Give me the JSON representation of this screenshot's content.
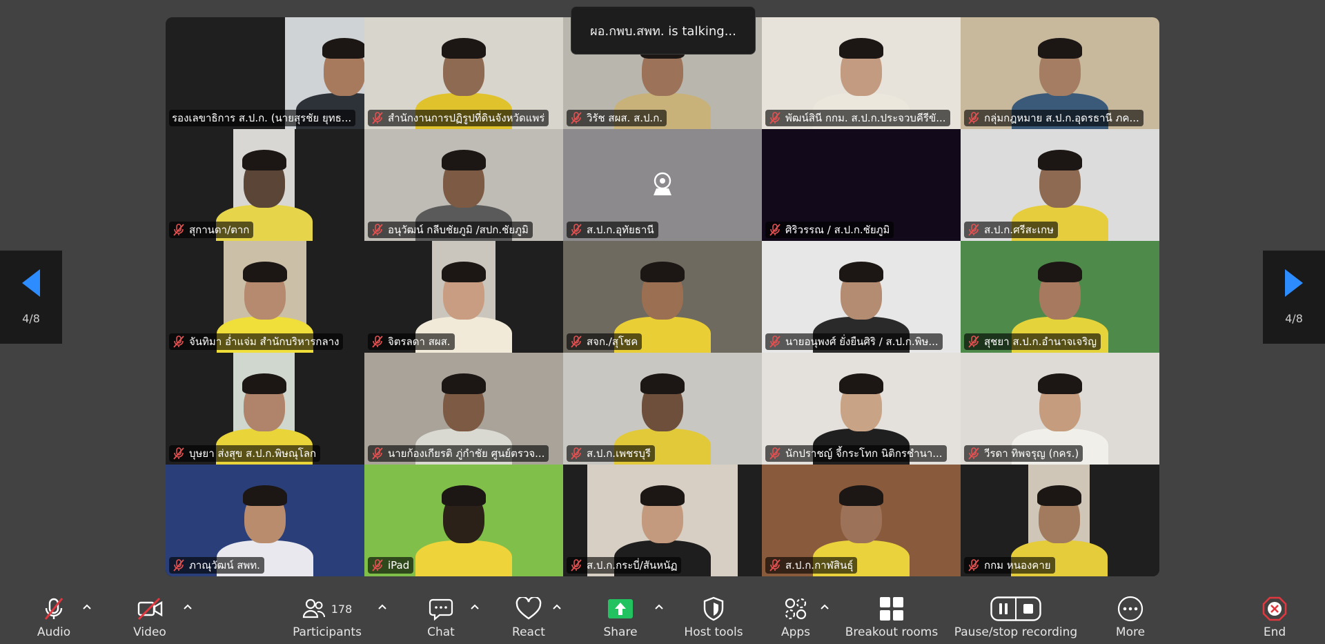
{
  "speaker_banner": "ผอ.กพบ.สพท. is talking...",
  "pager": {
    "left_label": "4/8",
    "right_label": "4/8"
  },
  "participants": [
    {
      "name": "รองเลขาธิการ ส.ป.ก. (นายสุรชัย ยุทธ...",
      "muted": false,
      "bg": "#cfd3d6",
      "cam": [
        60,
        60
      ],
      "skin": "#a77a5e",
      "shirt": "#2d3138"
    },
    {
      "name": "สำนักงานการปฏิรูปที่ดินจังหวัดแพร่",
      "muted": true,
      "bg": "#d8d5cc",
      "cam": [
        0,
        100
      ],
      "skin": "#8f6a52",
      "shirt": "#e0c22c"
    },
    {
      "name": "วิรัช  สผส.  ส.ป.ก.",
      "muted": true,
      "bg": "#b9b6ae",
      "cam": [
        0,
        100
      ],
      "skin": "#9c7258",
      "shirt": "#c9b27a"
    },
    {
      "name": "พัฒน์สินี กกม. ส.ป.ก.ประจวบคีรีขั...",
      "muted": true,
      "bg": "#e8e3da",
      "cam": [
        0,
        100
      ],
      "skin": "#c39b80",
      "shirt": "#ece7dd"
    },
    {
      "name": "กลุ่มกฎหมาย ส.ป.ก.อุดรธานี  ภค...",
      "muted": true,
      "bg": "#c8b89c",
      "cam": [
        0,
        100
      ],
      "skin": "#a57d62",
      "shirt": "#3b5a7a"
    },
    {
      "name": "สุกานดา/ตาก",
      "muted": true,
      "bg": "#d9d7d4",
      "cam": [
        34,
        31
      ],
      "skin": "#5a4536",
      "shirt": "#e6d44a"
    },
    {
      "name": "อนุวัฒน์ กลีบชัยภูมิ /สปก.ชัยภูมิ",
      "muted": true,
      "bg": "#bfbcb6",
      "cam": [
        0,
        100
      ],
      "skin": "#7c5a44",
      "shirt": "#5a5a5a"
    },
    {
      "name": "ส.ป.ก.อุทัยธานี",
      "muted": true,
      "bg": "#8c8a8d",
      "cam": [
        0,
        100
      ],
      "skin": "",
      "shirt": "",
      "placeholder": true
    },
    {
      "name": "ศิริวรรณ / ส.ป.ก.ชัยภูมิ",
      "muted": true,
      "bg": "#120a1a",
      "cam": [
        0,
        100
      ],
      "skin": "",
      "shirt": ""
    },
    {
      "name": "ส.ป.ก.ศรีสะเกษ",
      "muted": true,
      "bg": "#dcdcdc",
      "cam": [
        0,
        100
      ],
      "skin": "#8e6a52",
      "shirt": "#e6cd3e"
    },
    {
      "name": "จันทิมา อ่ำแจ่ม สำนักบริหารกลาง",
      "muted": true,
      "bg": "#cbbfa8",
      "cam": [
        29,
        42
      ],
      "skin": "#b68a6e",
      "shirt": "#f0de3a"
    },
    {
      "name": "จิตรลดา สผส.",
      "muted": true,
      "bg": "#cbc6bd",
      "cam": [
        34,
        32
      ],
      "skin": "#c99d82",
      "shirt": "#f1ead8"
    },
    {
      "name": "สจก./สุโชค",
      "muted": true,
      "bg": "#6e6a60",
      "cam": [
        0,
        100
      ],
      "skin": "#9b6f52",
      "shirt": "#e9cf35"
    },
    {
      "name": "นายอนุพงศ์  ยั่งยืนศิริ / ส.ป.ก.พิษ...",
      "muted": true,
      "bg": "#e7e7e7",
      "cam": [
        0,
        100
      ],
      "skin": "#b38c72",
      "shirt": "#2a2a2a"
    },
    {
      "name": "สุชยา ส.ป.ก.อำนาจเจริญ",
      "muted": true,
      "bg": "#4e8a4a",
      "cam": [
        0,
        100
      ],
      "skin": "#a77a60",
      "shirt": "#e5d33c"
    },
    {
      "name": "บุษยา ส่งสุข ส.ป.ก.พิษณุโลก",
      "muted": true,
      "bg": "#cfd7cf",
      "cam": [
        34,
        31
      ],
      "skin": "#b0846a",
      "shirt": "#e9d43a"
    },
    {
      "name": "นายก้องเกียรติ ภู่กำชัย ศูนย์ตรวจ...",
      "muted": true,
      "bg": "#a9a39a",
      "cam": [
        0,
        100
      ],
      "skin": "#7c5a44",
      "shirt": "#d9d9d2"
    },
    {
      "name": "ส.ป.ก.เพชรบุรี",
      "muted": true,
      "bg": "#c9c7c2",
      "cam": [
        0,
        100
      ],
      "skin": "#6d4f3c",
      "shirt": "#e2c93a"
    },
    {
      "name": "นักปราชญ์ จี้กระโทก นิติกรชำนา...",
      "muted": true,
      "bg": "#e4e1dd",
      "cam": [
        0,
        100
      ],
      "skin": "#c9a385",
      "shirt": "#1f1f1f"
    },
    {
      "name": "วีรดา ทิพจรุญ (กคร.)",
      "muted": true,
      "bg": "#dedad5",
      "cam": [
        0,
        100
      ],
      "skin": "#c59c7e",
      "shirt": "#f0efe9"
    },
    {
      "name": "ภาณุวัฒน์ สพท.",
      "muted": true,
      "bg": "#2a3f7a",
      "cam": [
        0,
        100
      ],
      "skin": "#b88c6c",
      "shirt": "#e8e8ee"
    },
    {
      "name": "iPad",
      "muted": true,
      "bg": "#7fbf4a",
      "cam": [
        0,
        100
      ],
      "skin": "#2b2118",
      "shirt": "#eed43a"
    },
    {
      "name": "ส.ป.ก.กระบี่/สันหนัฏ",
      "muted": true,
      "bg": "#d7cfc4",
      "cam": [
        12,
        76
      ],
      "skin": "#c49a7e",
      "shirt": "#1e1e1e"
    },
    {
      "name": "ส.ป.ก.กาฬสินธุ์",
      "muted": true,
      "bg": "#8a5a3c",
      "cam": [
        0,
        100
      ],
      "skin": "#9c7258",
      "shirt": "#e9d23c"
    },
    {
      "name": "กกม หนองคาย",
      "muted": true,
      "bg": "#cfc6b8",
      "cam": [
        34,
        31
      ],
      "skin": "#a27a5e",
      "shirt": "#e5cc3a"
    }
  ],
  "toolbar": {
    "audio": "Audio",
    "video": "Video",
    "participants": "Participants",
    "participants_count": "178",
    "chat": "Chat",
    "react": "React",
    "share": "Share",
    "host_tools": "Host tools",
    "apps": "Apps",
    "breakout_rooms": "Breakout rooms",
    "recording": "Pause/stop recording",
    "more": "More",
    "end": "End"
  },
  "colors": {
    "share_green": "#23c261",
    "end_red": "#e0383e",
    "muted_red": "#e25252"
  }
}
